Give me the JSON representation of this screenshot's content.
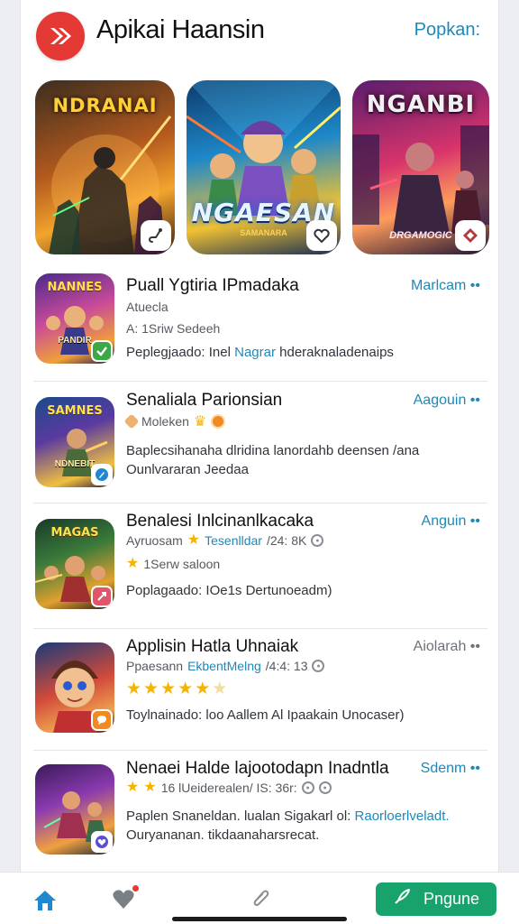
{
  "header": {
    "title": "Apikai Haansin",
    "action_label": "Popkan:",
    "logo_icon": "red-double-arrow-icon",
    "colors": {
      "logo": "#e53935",
      "action": "#1e88b8"
    }
  },
  "featured": [
    {
      "title": "NDRANAI",
      "subtitle": "",
      "badge_icon": "hook-icon"
    },
    {
      "title": "NGAESAN",
      "subtitle": "SAMANARA",
      "badge_icon": "heart-shield-icon"
    },
    {
      "title": "NGANBI",
      "subtitle": "DRGAMOGIC",
      "badge_icon": "diamond-icon"
    }
  ],
  "apps": [
    {
      "thumb_top": "NANNES",
      "thumb_bottom": "PANDIR",
      "title": "Puall Ygtiria IPmadaka",
      "action": "Marlcam ••",
      "line1": "Atuecla",
      "line2": "A: 1Sriw Sedeeh",
      "desc_plain": "Peplegjaado: Inel ",
      "desc_highlight": "Nagrar ",
      "desc_tail": "hderaknaladenaips",
      "badge_icon": "checkmark-icon",
      "badge_color": "#3aa845"
    },
    {
      "thumb_top": "SAMNES",
      "thumb_bottom": "NDNEBIT",
      "title": "Senaliala Parionsian",
      "action": "Aagouin ••",
      "line1_text": "Moleken",
      "desc_line1": "Baplecsihanaha dlridina lanordahb deensen /ana",
      "desc_line2": "Ounlvararan Jeedaa",
      "badge_icon": "pen-icon",
      "badge_color": "#1e88d0"
    },
    {
      "thumb_top": "MAGAS",
      "thumb_bottom": "",
      "title": "Benalesi Inlcinanlkacaka",
      "action": "Anguin ••",
      "line1_prefix": "Ayruosam ",
      "line1_highlight": "Tesenlldar",
      "line1_tail": "/24: 8K",
      "line2": "1Serw saloon",
      "desc": "Poplagaado: IOe1s Dertunoeadm)",
      "badge_icon": "share-icon",
      "badge_color": "#e0556a"
    },
    {
      "thumb_top": "",
      "thumb_bottom": "",
      "title": "Applisin Hatla Uhnaiak",
      "action": "Aiolarah ••",
      "line1_prefix": "Ppaesann ",
      "line1_highlight": "EkbentMelng",
      "line1_tail": "/4:4: 13",
      "rating": 5.5,
      "desc": "Toylnainado: loo Aallem Al Ipaakain Unocaser)",
      "badge_icon": "chat-bubble-icon",
      "badge_color": "#f08a24"
    },
    {
      "thumb_top": "",
      "thumb_bottom": "",
      "title": "Nenaei Halde lajootodapn Inadntla",
      "action": "Sdenm ••",
      "line1_text": "16 lUeiderealen/ IS: 36r:",
      "rating": 2,
      "desc_line1_plain": "Paplen Snaneldan. lualan Sigakarl ol: ",
      "desc_line1_highlight": "Raorloerlveladt.",
      "desc_line2": "Ouryananan. tikdaanaharsrecat.",
      "badge_icon": "heart-icon",
      "badge_color": "#5a4fcf"
    }
  ],
  "bottom_nav": {
    "home_icon": "home-icon",
    "favorites_icon": "heart-icon",
    "attach_icon": "paperclip-icon",
    "primary_label": "Pngune",
    "primary_icon": "rocket-icon",
    "colors": {
      "home": "#1e88d0",
      "primary": "#17a36b"
    }
  }
}
